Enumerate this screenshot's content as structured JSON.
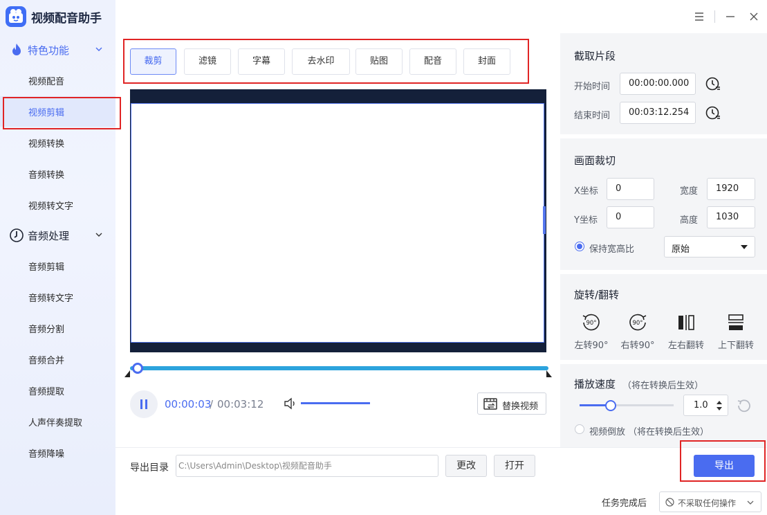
{
  "app": {
    "title": "视频配音助手"
  },
  "sidebar": {
    "sections": [
      {
        "label": "特色功能",
        "items": [
          "视频配音",
          "视频剪辑",
          "视频转换",
          "音频转换",
          "视频转文字"
        ]
      },
      {
        "label": "音频处理",
        "items": [
          "音频剪辑",
          "音频转文字",
          "音频分割",
          "音频合并",
          "音频提取",
          "人声伴奏提取",
          "音频降噪"
        ]
      }
    ],
    "active_item": "视频剪辑"
  },
  "tabs": [
    "裁剪",
    "滤镜",
    "字幕",
    "去水印",
    "贴图",
    "配音",
    "封面"
  ],
  "active_tab": "裁剪",
  "player": {
    "current_time": "00:00:03",
    "separator": "/",
    "total_time": "00:03:12",
    "progress": 0.016,
    "volume": 1.0,
    "replace_label": "替换视频"
  },
  "clip": {
    "title": "截取片段",
    "start_label": "开始时间",
    "start_value": "00:00:00.000",
    "end_label": "结束时间",
    "end_value": "00:03:12.254"
  },
  "crop": {
    "title": "画面裁切",
    "x_label": "X坐标",
    "x_value": "0",
    "y_label": "Y坐标",
    "y_value": "0",
    "width_label": "宽度",
    "width_value": "1920",
    "height_label": "高度",
    "height_value": "1030",
    "keep_ratio_label": "保持宽高比",
    "keep_ratio_checked": true,
    "ratio_option": "原始"
  },
  "rotate": {
    "title": "旋转/翻转",
    "items": [
      "左转90°",
      "右转90°",
      "左右翻转",
      "上下翻转"
    ],
    "badge": "90°"
  },
  "speed": {
    "title": "播放速度",
    "note": "（将在转换后生效）",
    "value": "1.0",
    "reverse_label": "视频倒放",
    "reverse_note": "（将在转换后生效）"
  },
  "bottom": {
    "export_dir_label": "导出目录",
    "export_path": "C:\\Users\\Admin\\Desktop\\视频配音助手",
    "change_label": "更改",
    "open_label": "打开",
    "export_label": "导出",
    "after_task_label": "任务完成后",
    "after_task_value": "不采取任何操作"
  },
  "colors": {
    "accent": "#4a6cf0",
    "highlight_box": "#e02424",
    "video_bg": "#14203a",
    "progress": "#2ca3dd"
  }
}
